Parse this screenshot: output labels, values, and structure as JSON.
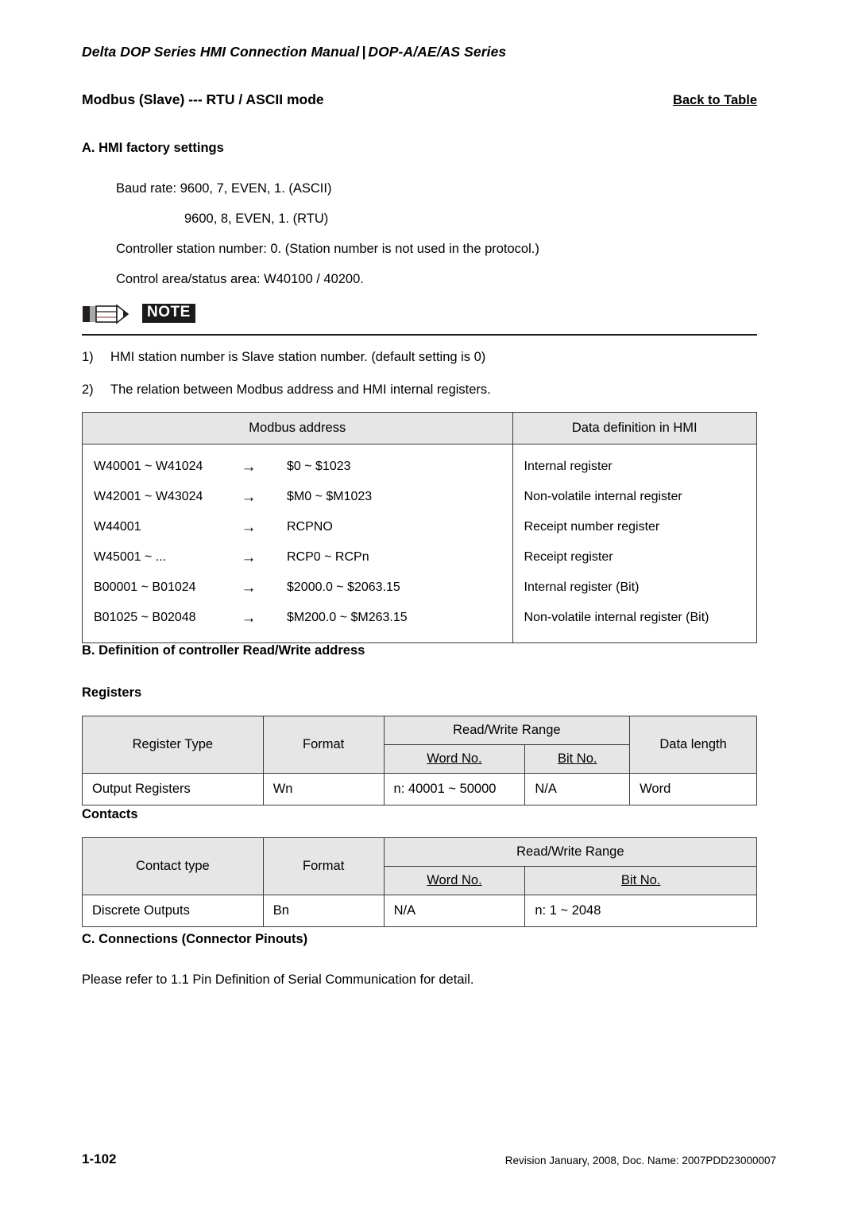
{
  "header": {
    "manual_title": "Delta DOP Series HMI Connection Manual",
    "separator": "|",
    "series": "DOP-A/AE/AS Series"
  },
  "title_row": {
    "page_title": "Modbus (Slave) ---  RTU / ASCII mode",
    "back_link": "Back to Table"
  },
  "section_a": {
    "heading": "A. HMI factory settings",
    "lines": [
      "Baud rate:  9600, 7, EVEN, 1. (ASCII)",
      "9600, 8, EVEN, 1. (RTU)",
      "Controller station number: 0. (Station number is not used in the protocol.)",
      "Control area/status area: W40100 / 40200."
    ]
  },
  "note": {
    "label": "NOTE",
    "icon": "pencil-icon",
    "items": [
      {
        "num": "1)",
        "text": "HMI station number is Slave station number. (default setting is 0)"
      },
      {
        "num": "2)",
        "text": "The relation between Modbus address and HMI internal registers."
      }
    ]
  },
  "modbus_table": {
    "headers": [
      "Modbus address",
      "Data definition in HMI"
    ],
    "arrow": "→",
    "rows": [
      {
        "address": "W40001 ~ W41024",
        "mapped": "$0 ~ $1023",
        "definition": "Internal register"
      },
      {
        "address": "W42001 ~ W43024",
        "mapped": "$M0 ~ $M1023",
        "definition": "Non-volatile internal register"
      },
      {
        "address": "W44001",
        "mapped": "RCPNO",
        "definition": "Receipt number register"
      },
      {
        "address": "W45001 ~ ...",
        "mapped": "RCP0 ~ RCPn",
        "definition": "Receipt register"
      },
      {
        "address": "B00001 ~ B01024",
        "mapped": "$2000.0 ~ $2063.15",
        "definition": "Internal register (Bit)"
      },
      {
        "address": "B01025 ~ B02048",
        "mapped": "$M200.0 ~ $M263.15",
        "definition": "Non-volatile internal register (Bit)"
      }
    ]
  },
  "section_b": {
    "heading": "B. Definition of controller Read/Write address",
    "registers_label": "Registers",
    "contacts_label": "Contacts"
  },
  "registers_table": {
    "headers": {
      "type": "Register Type",
      "format": "Format",
      "range_group": "Read/Write Range",
      "word_no": "Word No.",
      "bit_no": "Bit No.",
      "data_length": "Data length"
    },
    "rows": [
      {
        "type": "Output Registers",
        "format": "Wn",
        "word_no": "n: 40001 ~ 50000",
        "bit_no": "N/A",
        "data_length": "Word"
      }
    ]
  },
  "contacts_table": {
    "headers": {
      "type": "Contact type",
      "format": "Format",
      "range_group": "Read/Write Range",
      "word_no": "Word No.",
      "bit_no": "Bit No."
    },
    "rows": [
      {
        "type": "Discrete Outputs",
        "format": "Bn",
        "word_no": "N/A",
        "bit_no": "n: 1 ~ 2048"
      }
    ]
  },
  "section_c": {
    "heading": "C. Connections (Connector Pinouts)",
    "text": "Please refer to 1.1 Pin Definition of Serial Communication for detail."
  },
  "footer": {
    "page_number": "1-102",
    "revision": "Revision January, 2008, Doc. Name: 2007PDD23000007"
  }
}
